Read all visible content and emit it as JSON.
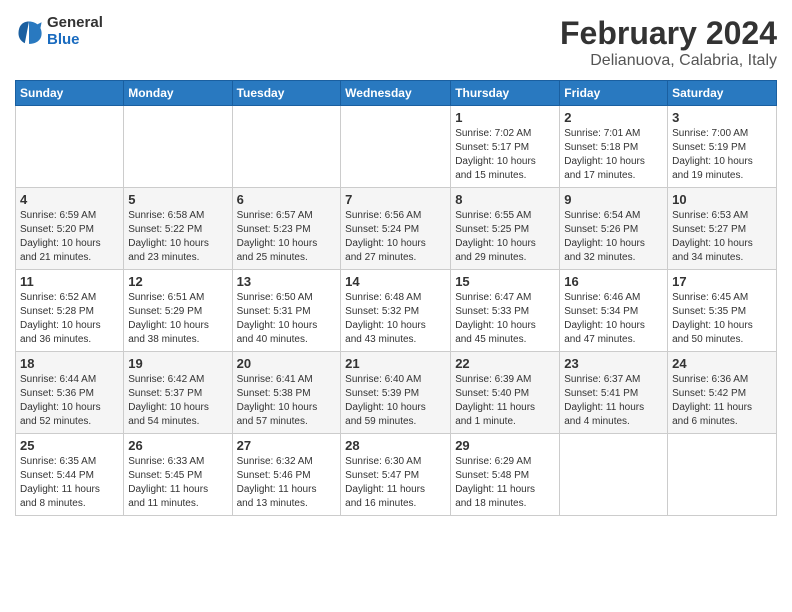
{
  "logo": {
    "general": "General",
    "blue": "Blue"
  },
  "title": "February 2024",
  "subtitle": "Delianuova, Calabria, Italy",
  "headers": [
    "Sunday",
    "Monday",
    "Tuesday",
    "Wednesday",
    "Thursday",
    "Friday",
    "Saturday"
  ],
  "weeks": [
    [
      {
        "day": "",
        "info": ""
      },
      {
        "day": "",
        "info": ""
      },
      {
        "day": "",
        "info": ""
      },
      {
        "day": "",
        "info": ""
      },
      {
        "day": "1",
        "info": "Sunrise: 7:02 AM\nSunset: 5:17 PM\nDaylight: 10 hours\nand 15 minutes."
      },
      {
        "day": "2",
        "info": "Sunrise: 7:01 AM\nSunset: 5:18 PM\nDaylight: 10 hours\nand 17 minutes."
      },
      {
        "day": "3",
        "info": "Sunrise: 7:00 AM\nSunset: 5:19 PM\nDaylight: 10 hours\nand 19 minutes."
      }
    ],
    [
      {
        "day": "4",
        "info": "Sunrise: 6:59 AM\nSunset: 5:20 PM\nDaylight: 10 hours\nand 21 minutes."
      },
      {
        "day": "5",
        "info": "Sunrise: 6:58 AM\nSunset: 5:22 PM\nDaylight: 10 hours\nand 23 minutes."
      },
      {
        "day": "6",
        "info": "Sunrise: 6:57 AM\nSunset: 5:23 PM\nDaylight: 10 hours\nand 25 minutes."
      },
      {
        "day": "7",
        "info": "Sunrise: 6:56 AM\nSunset: 5:24 PM\nDaylight: 10 hours\nand 27 minutes."
      },
      {
        "day": "8",
        "info": "Sunrise: 6:55 AM\nSunset: 5:25 PM\nDaylight: 10 hours\nand 29 minutes."
      },
      {
        "day": "9",
        "info": "Sunrise: 6:54 AM\nSunset: 5:26 PM\nDaylight: 10 hours\nand 32 minutes."
      },
      {
        "day": "10",
        "info": "Sunrise: 6:53 AM\nSunset: 5:27 PM\nDaylight: 10 hours\nand 34 minutes."
      }
    ],
    [
      {
        "day": "11",
        "info": "Sunrise: 6:52 AM\nSunset: 5:28 PM\nDaylight: 10 hours\nand 36 minutes."
      },
      {
        "day": "12",
        "info": "Sunrise: 6:51 AM\nSunset: 5:29 PM\nDaylight: 10 hours\nand 38 minutes."
      },
      {
        "day": "13",
        "info": "Sunrise: 6:50 AM\nSunset: 5:31 PM\nDaylight: 10 hours\nand 40 minutes."
      },
      {
        "day": "14",
        "info": "Sunrise: 6:48 AM\nSunset: 5:32 PM\nDaylight: 10 hours\nand 43 minutes."
      },
      {
        "day": "15",
        "info": "Sunrise: 6:47 AM\nSunset: 5:33 PM\nDaylight: 10 hours\nand 45 minutes."
      },
      {
        "day": "16",
        "info": "Sunrise: 6:46 AM\nSunset: 5:34 PM\nDaylight: 10 hours\nand 47 minutes."
      },
      {
        "day": "17",
        "info": "Sunrise: 6:45 AM\nSunset: 5:35 PM\nDaylight: 10 hours\nand 50 minutes."
      }
    ],
    [
      {
        "day": "18",
        "info": "Sunrise: 6:44 AM\nSunset: 5:36 PM\nDaylight: 10 hours\nand 52 minutes."
      },
      {
        "day": "19",
        "info": "Sunrise: 6:42 AM\nSunset: 5:37 PM\nDaylight: 10 hours\nand 54 minutes."
      },
      {
        "day": "20",
        "info": "Sunrise: 6:41 AM\nSunset: 5:38 PM\nDaylight: 10 hours\nand 57 minutes."
      },
      {
        "day": "21",
        "info": "Sunrise: 6:40 AM\nSunset: 5:39 PM\nDaylight: 10 hours\nand 59 minutes."
      },
      {
        "day": "22",
        "info": "Sunrise: 6:39 AM\nSunset: 5:40 PM\nDaylight: 11 hours\nand 1 minute."
      },
      {
        "day": "23",
        "info": "Sunrise: 6:37 AM\nSunset: 5:41 PM\nDaylight: 11 hours\nand 4 minutes."
      },
      {
        "day": "24",
        "info": "Sunrise: 6:36 AM\nSunset: 5:42 PM\nDaylight: 11 hours\nand 6 minutes."
      }
    ],
    [
      {
        "day": "25",
        "info": "Sunrise: 6:35 AM\nSunset: 5:44 PM\nDaylight: 11 hours\nand 8 minutes."
      },
      {
        "day": "26",
        "info": "Sunrise: 6:33 AM\nSunset: 5:45 PM\nDaylight: 11 hours\nand 11 minutes."
      },
      {
        "day": "27",
        "info": "Sunrise: 6:32 AM\nSunset: 5:46 PM\nDaylight: 11 hours\nand 13 minutes."
      },
      {
        "day": "28",
        "info": "Sunrise: 6:30 AM\nSunset: 5:47 PM\nDaylight: 11 hours\nand 16 minutes."
      },
      {
        "day": "29",
        "info": "Sunrise: 6:29 AM\nSunset: 5:48 PM\nDaylight: 11 hours\nand 18 minutes."
      },
      {
        "day": "",
        "info": ""
      },
      {
        "day": "",
        "info": ""
      }
    ]
  ]
}
